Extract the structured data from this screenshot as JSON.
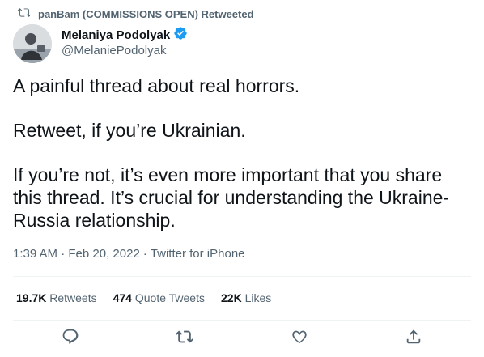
{
  "retweet_banner": {
    "icon": "retweet-icon",
    "text": "panBam (COMMISSIONS OPEN) Retweeted"
  },
  "author": {
    "display_name": "Melaniya Podolyak",
    "handle": "@MelaniePodolyak",
    "verified_icon": "verified-badge-icon"
  },
  "tweet": {
    "paragraphs": [
      "A painful thread about real horrors.",
      "Retweet, if you’re Ukrainian.",
      "If you’re not, it’s even more important that you share this thread. It’s crucial for understanding the Ukraine-Russia relationship."
    ]
  },
  "meta": {
    "time": "1:39 AM",
    "separator": "·",
    "date": "Feb 20, 2022",
    "source": "Twitter for iPhone"
  },
  "stats": {
    "retweets_count": "19.7K",
    "retweets_label": "Retweets",
    "quotes_count": "474",
    "quotes_label": "Quote Tweets",
    "likes_count": "22K",
    "likes_label": "Likes"
  },
  "actions": [
    "reply-icon",
    "retweet-icon",
    "like-icon",
    "share-icon"
  ],
  "colors": {
    "text": "#0f1419",
    "secondary": "#536471",
    "verified": "#1d9bf0",
    "divider": "#eff3f4"
  }
}
